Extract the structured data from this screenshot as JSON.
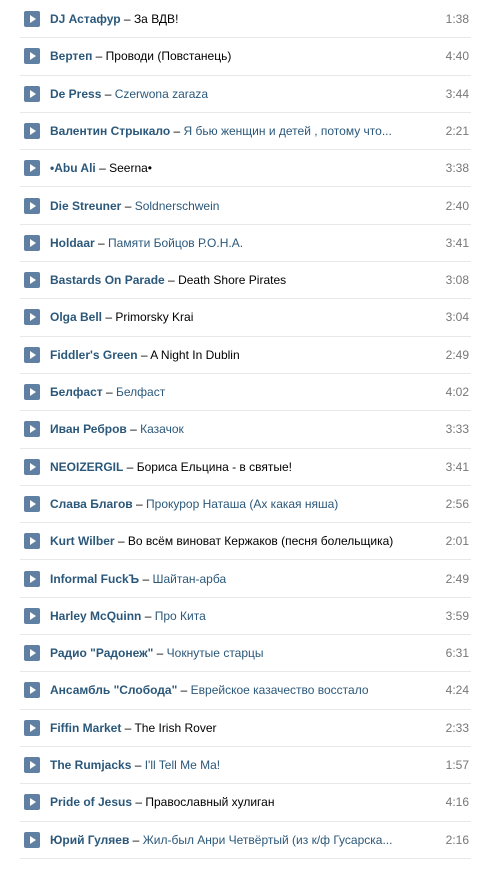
{
  "icons": {
    "play": "play-icon"
  },
  "colors": {
    "artist": "#2b587a",
    "play_button": "#5f7fa3",
    "duration": "#777777"
  },
  "tracks": [
    {
      "artist": "DJ Астафур",
      "title": "За ВДВ!",
      "title_link": false,
      "duration": "1:38"
    },
    {
      "artist": "Вертеп",
      "title": "Проводи (Повстанець)",
      "title_link": false,
      "duration": "4:40"
    },
    {
      "artist": "De Press",
      "title": "Czerwona zaraza",
      "title_link": true,
      "duration": "3:44"
    },
    {
      "artist": "Валентин Стрыкало",
      "title": "Я бью женщин и детей , потому что...",
      "title_link": true,
      "duration": "2:21"
    },
    {
      "artist": "•Abu Ali",
      "title": "Seerna•",
      "title_link": false,
      "duration": "3:38"
    },
    {
      "artist": "Die Streuner",
      "title": "Soldnerschwein",
      "title_link": true,
      "duration": "2:40"
    },
    {
      "artist": "Holdaar",
      "title": "Памяти Бойцов Р.О.Н.А.",
      "title_link": true,
      "duration": "3:41"
    },
    {
      "artist": "Bastards On Parade",
      "title": "Death Shore Pirates",
      "title_link": false,
      "duration": "3:08"
    },
    {
      "artist": "Olga Bell",
      "title": "Primorsky Krai",
      "title_link": false,
      "duration": "3:04"
    },
    {
      "artist": "Fiddler's Green",
      "title": "A Night In Dublin",
      "title_link": false,
      "duration": "2:49"
    },
    {
      "artist": "Белфаст",
      "title": "Белфаст",
      "title_link": true,
      "duration": "4:02"
    },
    {
      "artist": "Иван Ребров",
      "title": "Казачок",
      "title_link": true,
      "duration": "3:33"
    },
    {
      "artist": "NEOIZERGIL",
      "title": "Бориса Ельцина - в святые!",
      "title_link": false,
      "duration": "3:41"
    },
    {
      "artist": "Слава Благов",
      "title": "Прокурор Наташа (Ах какая няша)",
      "title_link": true,
      "duration": "2:56"
    },
    {
      "artist": "Kurt Wilber",
      "title": "Во всём виноват Кержаков (песня болельщика)",
      "title_link": false,
      "duration": "2:01"
    },
    {
      "artist": "Informal FuckЪ",
      "title": "Шайтан-арба",
      "title_link": true,
      "duration": "2:49"
    },
    {
      "artist": "Harley McQuinn",
      "title": "Про Кита",
      "title_link": true,
      "duration": "3:59"
    },
    {
      "artist": "Радио \"Радонеж\"",
      "title": "Чокнутые старцы",
      "title_link": true,
      "duration": "6:31"
    },
    {
      "artist": "Ансамбль \"Слобода\"",
      "title": "Еврейское казачество восстало",
      "title_link": true,
      "duration": "4:24"
    },
    {
      "artist": "Fiffin Market",
      "title": "The Irish Rover",
      "title_link": false,
      "duration": "2:33"
    },
    {
      "artist": "The Rumjacks",
      "title": "I'll Tell Me Ma!",
      "title_link": true,
      "duration": "1:57"
    },
    {
      "artist": "Pride of Jesus",
      "title": "Православный хулиган",
      "title_link": false,
      "duration": "4:16"
    },
    {
      "artist": "Юрий Гуляев",
      "title": "Жил-был Анри Четвёртый (из к/ф Гусарска...",
      "title_link": true,
      "duration": "2:16"
    }
  ]
}
